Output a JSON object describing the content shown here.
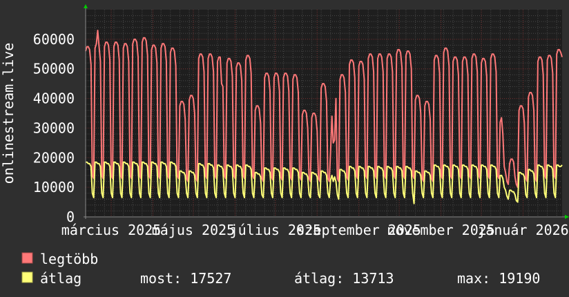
{
  "chart_data": {
    "type": "line",
    "ylabel": "onlinestream.live",
    "ylim": [
      0,
      70000
    ],
    "y_ticks": [
      "0",
      "10000",
      "20000",
      "30000",
      "40000",
      "50000",
      "60000"
    ],
    "x_ticks": [
      {
        "date": "2025-03-01",
        "label": "március 2025"
      },
      {
        "date": "2025-05-01",
        "label": "május 2025"
      },
      {
        "date": "2025-07-01",
        "label": "július 2025"
      },
      {
        "date": "2025-09-01",
        "label": "szeptember 2025"
      },
      {
        "date": "2025-11-01",
        "label": "november 2025"
      },
      {
        "date": "2026-01-01",
        "label": "január 2026"
      }
    ],
    "x_start": "2025-02-10",
    "x_step_days": 1,
    "grid": true,
    "legend_position": "bottom-left",
    "colors": {
      "background": "#2f2f2f",
      "plot": "#1e1e1e",
      "grid_minor": "#4a4a4a",
      "grid_major": "#7a3030",
      "arrow": "#00cc00"
    },
    "series": [
      {
        "name": "legtöbb",
        "color": "#ff7878",
        "values": [
          56000,
          57500,
          57500,
          56500,
          51500,
          14000,
          13000,
          57000,
          58500,
          63000,
          57500,
          52500,
          14000,
          13000,
          57500,
          59000,
          59000,
          58000,
          53000,
          14000,
          13000,
          57500,
          59000,
          59000,
          58000,
          53000,
          14000,
          13000,
          57000,
          58500,
          58500,
          57500,
          52500,
          14000,
          13000,
          58500,
          60000,
          60000,
          59000,
          54000,
          14000,
          13000,
          59000,
          60500,
          60500,
          59500,
          54500,
          14000,
          13000,
          56500,
          58000,
          58000,
          57000,
          52000,
          14000,
          13000,
          57000,
          58500,
          58500,
          57500,
          52500,
          14000,
          13000,
          55500,
          57000,
          57000,
          56000,
          51000,
          14000,
          13000,
          37500,
          39000,
          39000,
          38000,
          33000,
          13000,
          12000,
          39500,
          41000,
          41000,
          40000,
          35000,
          13000,
          12000,
          53500,
          55000,
          55000,
          54000,
          49000,
          14000,
          13000,
          53500,
          55000,
          55000,
          54000,
          49000,
          14000,
          13000,
          52500,
          54000,
          54000,
          45000,
          44000,
          14000,
          13000,
          52000,
          53500,
          53500,
          52500,
          47500,
          14000,
          13000,
          50500,
          52000,
          52000,
          51000,
          46000,
          14000,
          13000,
          53000,
          54500,
          54500,
          53500,
          48500,
          14000,
          13000,
          36000,
          37500,
          37500,
          36500,
          31500,
          13000,
          12000,
          47000,
          48500,
          48500,
          47500,
          42500,
          13500,
          12500,
          47000,
          48500,
          48500,
          47500,
          42500,
          13500,
          12500,
          47000,
          48500,
          48500,
          47500,
          42500,
          13500,
          12500,
          46500,
          48000,
          48000,
          47000,
          42000,
          13500,
          12500,
          34500,
          36000,
          36000,
          35000,
          30000,
          13000,
          12000,
          33500,
          35000,
          35000,
          34000,
          29000,
          13000,
          12000,
          43500,
          45000,
          45000,
          44000,
          39000,
          13000,
          12000,
          22000,
          34000,
          25000,
          26000,
          40000,
          13000,
          12000,
          46500,
          48000,
          48000,
          47000,
          42000,
          13500,
          12500,
          51500,
          53000,
          53000,
          52000,
          47000,
          14000,
          13000,
          51000,
          52500,
          52500,
          51500,
          46500,
          14000,
          13000,
          53500,
          55000,
          55000,
          54000,
          49000,
          14000,
          13000,
          53500,
          55000,
          55000,
          54000,
          49000,
          14000,
          13000,
          53500,
          55000,
          55000,
          54000,
          49000,
          14000,
          13000,
          55000,
          56500,
          56500,
          55500,
          50500,
          14000,
          13000,
          54500,
          56000,
          56000,
          55000,
          50000,
          14000,
          13000,
          39500,
          41000,
          41000,
          40000,
          35000,
          13000,
          12000,
          37500,
          39000,
          39000,
          38000,
          33000,
          13000,
          12000,
          53000,
          54500,
          54500,
          53500,
          48500,
          14000,
          13000,
          55500,
          57000,
          57000,
          56000,
          51000,
          14000,
          13000,
          52500,
          54000,
          54000,
          53000,
          48000,
          14000,
          13000,
          52500,
          54000,
          54000,
          53000,
          48000,
          14000,
          13000,
          53500,
          55000,
          55000,
          54000,
          49000,
          14000,
          13000,
          52000,
          53500,
          53500,
          52500,
          47500,
          14000,
          13000,
          53500,
          55000,
          55000,
          54000,
          49000,
          14000,
          13000,
          32000,
          33500,
          28000,
          17000,
          15000,
          12000,
          11000,
          18000,
          19500,
          19500,
          18500,
          13500,
          11000,
          10000,
          36000,
          37500,
          37500,
          36500,
          31500,
          13000,
          12000,
          40500,
          42000,
          42000,
          41000,
          36000,
          13000,
          12000,
          52500,
          54000,
          54000,
          53000,
          48000,
          14000,
          13000,
          53000,
          54500,
          54500,
          53500,
          48500,
          14000,
          13000,
          55000,
          56500,
          56500,
          55500,
          54000
        ]
      },
      {
        "name": "átlag",
        "color": "#ffff78",
        "values": [
          18500,
          18500,
          18000,
          18000,
          17000,
          8000,
          6500,
          18500,
          18500,
          18000,
          18000,
          17000,
          8000,
          6500,
          18500,
          18500,
          18000,
          18000,
          17000,
          8000,
          6500,
          18500,
          18500,
          18000,
          18000,
          17000,
          8000,
          6500,
          18500,
          18500,
          18000,
          18000,
          17000,
          8000,
          6500,
          18500,
          18500,
          18000,
          18000,
          17000,
          8000,
          6500,
          18500,
          18500,
          18000,
          18000,
          17000,
          8000,
          6500,
          18500,
          18500,
          18000,
          18000,
          17000,
          8000,
          6500,
          18500,
          18500,
          18000,
          18000,
          17000,
          8000,
          6500,
          18500,
          18500,
          18000,
          18000,
          17000,
          8000,
          6500,
          15500,
          15500,
          15000,
          15000,
          14000,
          8000,
          6500,
          15500,
          15500,
          15000,
          15000,
          14000,
          8000,
          6500,
          18000,
          18000,
          17500,
          17500,
          16500,
          8000,
          6500,
          18000,
          18000,
          17500,
          17500,
          16500,
          8000,
          6500,
          17500,
          17500,
          17000,
          17000,
          16000,
          8000,
          6500,
          17500,
          17500,
          17000,
          17000,
          16000,
          8000,
          6500,
          17500,
          17500,
          17000,
          17000,
          16000,
          8000,
          6500,
          17500,
          17500,
          17000,
          17000,
          16000,
          8000,
          6500,
          15000,
          15000,
          14500,
          14500,
          13500,
          7500,
          6500,
          16500,
          16500,
          16000,
          16000,
          15000,
          8000,
          6500,
          16500,
          16500,
          16000,
          16000,
          15000,
          8000,
          6500,
          16500,
          16500,
          16000,
          16000,
          15000,
          8000,
          6500,
          16500,
          16500,
          16000,
          16000,
          15000,
          8000,
          6500,
          15000,
          15000,
          14500,
          14500,
          13500,
          7500,
          6500,
          15000,
          15000,
          14500,
          14500,
          13500,
          7500,
          6500,
          15500,
          15500,
          15000,
          15000,
          14000,
          8000,
          6500,
          12500,
          14000,
          12000,
          13500,
          12000,
          7500,
          6000,
          16000,
          16000,
          15500,
          15500,
          14500,
          8000,
          6500,
          17000,
          17000,
          16500,
          16500,
          15500,
          8000,
          6500,
          17000,
          17000,
          16500,
          16500,
          15500,
          8000,
          6500,
          17000,
          17000,
          16500,
          16500,
          15500,
          8000,
          6500,
          17000,
          17000,
          16500,
          16500,
          15500,
          8000,
          6500,
          17000,
          17000,
          16500,
          16500,
          15500,
          8000,
          6500,
          17000,
          17000,
          16500,
          16500,
          15500,
          8000,
          6500,
          17000,
          17000,
          16500,
          16500,
          15500,
          8000,
          4500,
          15500,
          15500,
          15000,
          15000,
          14000,
          8000,
          6500,
          15500,
          15500,
          15000,
          15000,
          14000,
          8000,
          6500,
          17500,
          17500,
          17000,
          17000,
          16000,
          8000,
          6500,
          17500,
          17500,
          17000,
          17000,
          16000,
          8000,
          6500,
          17500,
          17500,
          17000,
          17000,
          16000,
          8000,
          6500,
          17500,
          17500,
          17000,
          17000,
          16000,
          8000,
          6500,
          17500,
          17500,
          17000,
          17000,
          16000,
          8000,
          6500,
          17500,
          17500,
          17000,
          17000,
          16000,
          8000,
          6500,
          17500,
          17500,
          17000,
          17000,
          16000,
          8000,
          6500,
          14000,
          14000,
          13000,
          10000,
          9000,
          7000,
          6000,
          9000,
          9000,
          8500,
          8500,
          7500,
          5500,
          5000,
          15000,
          15000,
          14500,
          14500,
          13500,
          7500,
          6500,
          16000,
          16000,
          15500,
          15500,
          14500,
          8000,
          6500,
          17500,
          17500,
          17000,
          17000,
          16000,
          8000,
          6500,
          17500,
          17500,
          17000,
          17000,
          16000,
          8000,
          6500,
          17500,
          17500,
          17000,
          17000,
          17527
        ]
      }
    ]
  },
  "legend": {
    "max_label": "legtöbb",
    "avg_label": "átlag",
    "current": "most: 17527",
    "average": "átlag: 13713",
    "maximum": "max: 19190"
  }
}
